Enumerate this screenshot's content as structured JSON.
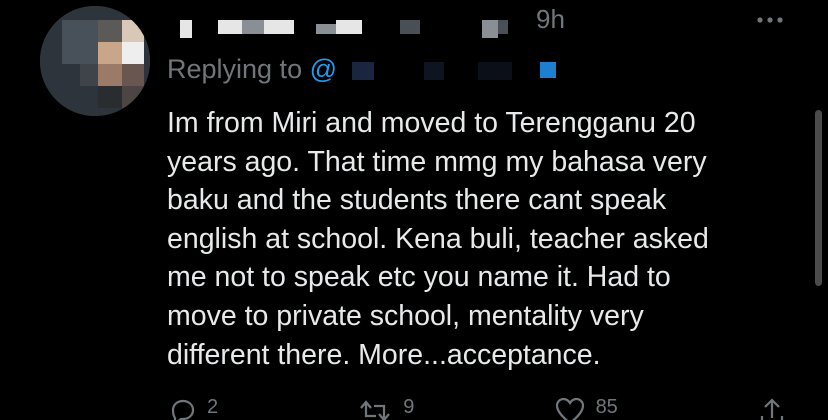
{
  "tweet": {
    "timestamp": "9h",
    "more_icon": "more-horizontal-icon",
    "replying_to": {
      "prefix": "Replying to",
      "handle": "@"
    },
    "body": "Im from Miri and moved to Terengganu 20\nyears ago. That time mmg my bahasa very\nbaku and the students there cant speak\nenglish at school. Kena buli, teacher asked\nme not to speak etc you name it. Had to\nmove to private school, mentality very\ndifferent there. More...acceptance.",
    "actions": {
      "reply": {
        "icon": "reply-bubble-icon",
        "count": "2"
      },
      "retweet": {
        "icon": "retweet-icon",
        "count": "9"
      },
      "like": {
        "icon": "heart-icon",
        "count": "85"
      },
      "share": {
        "icon": "share-icon"
      }
    }
  },
  "colors": {
    "background": "#000000",
    "text_primary": "#e7e9ea",
    "text_secondary": "#71767b",
    "accent": "#1d9bf0"
  }
}
